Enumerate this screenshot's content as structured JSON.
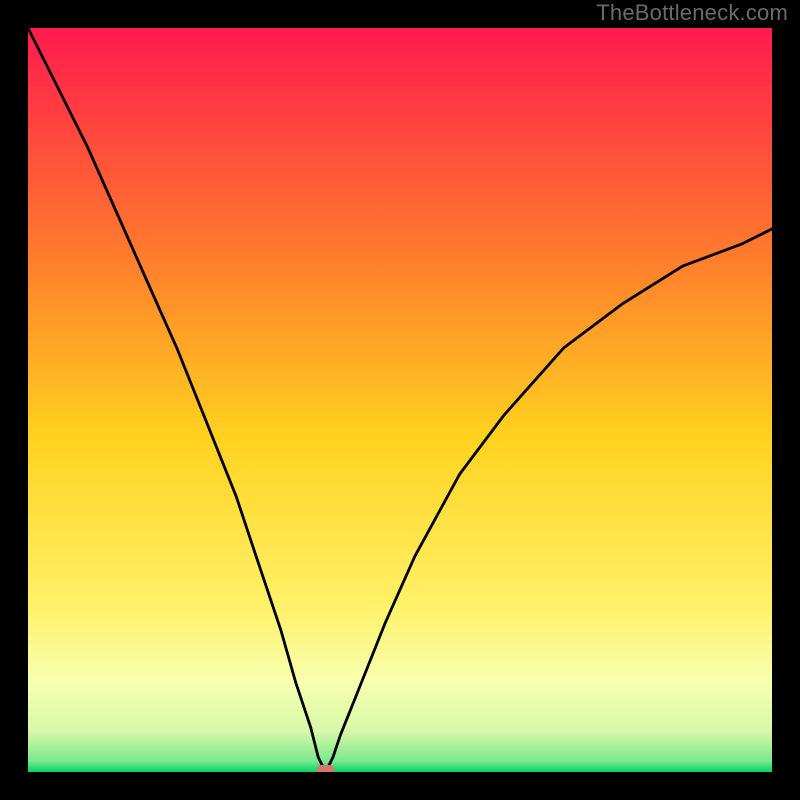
{
  "watermark": "TheBottleneck.com",
  "chart_data": {
    "type": "line",
    "title": "",
    "xlabel": "",
    "ylabel": "",
    "x_range": [
      0,
      100
    ],
    "y_range": [
      0,
      100
    ],
    "grid": false,
    "legend": false,
    "curve_description": "V-shaped bottleneck curve; minimum near x≈40",
    "minimum_x": 40,
    "minimum_y": 0,
    "marker": {
      "x": 40,
      "y": 0,
      "color": "#d6776f"
    },
    "background_gradient": {
      "stops": [
        {
          "offset": 0.0,
          "color": "#ff1a4e"
        },
        {
          "offset": 0.3,
          "color": "#ff7a2d"
        },
        {
          "offset": 0.55,
          "color": "#ffd21f"
        },
        {
          "offset": 0.78,
          "color": "#fff26a"
        },
        {
          "offset": 0.88,
          "color": "#f7ffb0"
        },
        {
          "offset": 0.945,
          "color": "#d8f7a8"
        },
        {
          "offset": 0.985,
          "color": "#7ce88f"
        },
        {
          "offset": 1.0,
          "color": "#00d563"
        }
      ]
    },
    "series": [
      {
        "name": "bottleneck-curve",
        "x": [
          0,
          4,
          8,
          12,
          16,
          20,
          24,
          28,
          31,
          34,
          36,
          38,
          39,
          40,
          41,
          42,
          44,
          48,
          52,
          58,
          64,
          72,
          80,
          88,
          96,
          100
        ],
        "y": [
          100,
          92,
          84,
          75,
          66,
          57,
          47,
          37,
          28,
          19,
          12,
          6,
          2,
          0,
          2,
          5,
          10,
          20,
          29,
          40,
          48,
          57,
          63,
          68,
          71,
          73
        ]
      }
    ]
  }
}
